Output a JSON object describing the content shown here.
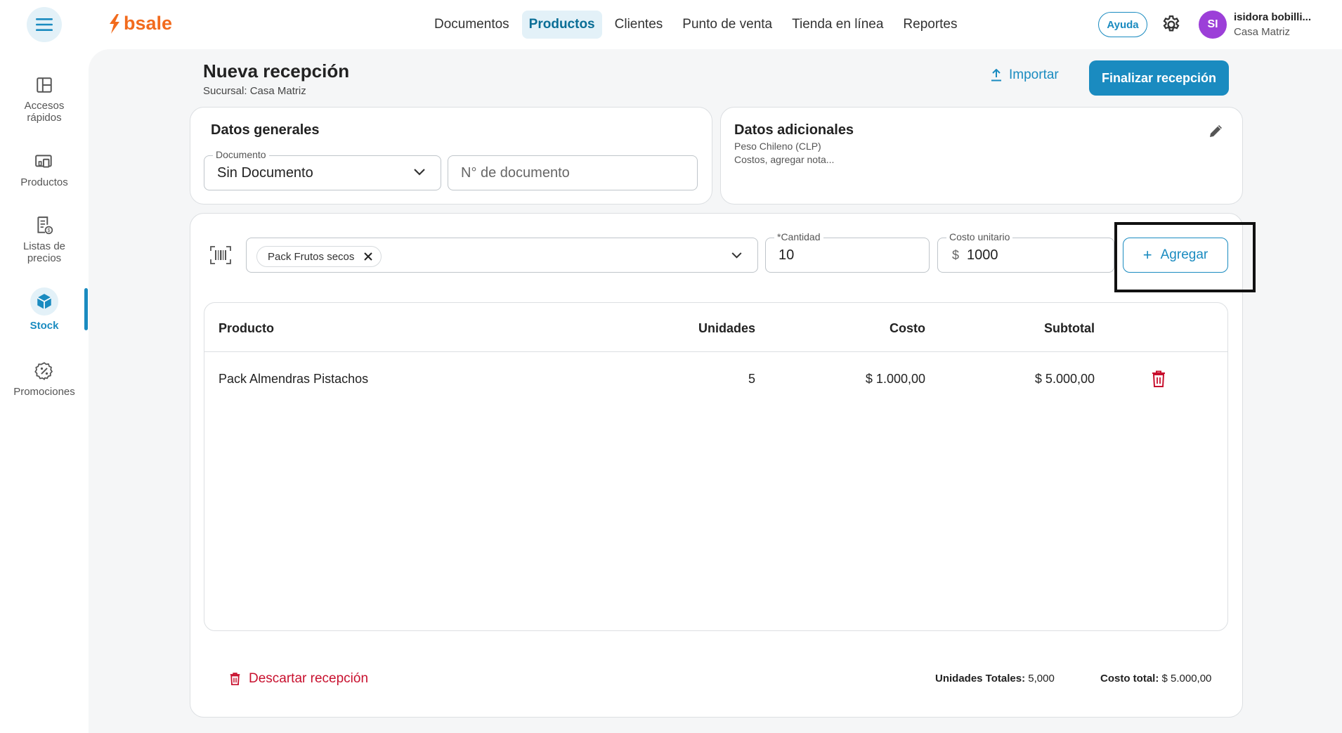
{
  "brand": {
    "name": "bsale",
    "color": "#f26b1d"
  },
  "nav": {
    "items": [
      "Documentos",
      "Productos",
      "Clientes",
      "Punto de venta",
      "Tienda en línea",
      "Reportes"
    ],
    "active": "Productos"
  },
  "header": {
    "help_label": "Ayuda",
    "avatar_initials": "SI",
    "user_name": "isidora bobilli...",
    "user_branch": "Casa Matriz"
  },
  "sidebar": {
    "items": [
      {
        "label": "Accesos rápidos",
        "icon": "layout-icon"
      },
      {
        "label": "Productos",
        "icon": "devices-icon"
      },
      {
        "label": "Listas de precios",
        "icon": "price-list-icon"
      },
      {
        "label": "Stock",
        "icon": "box-icon",
        "active": true
      },
      {
        "label": "Promociones",
        "icon": "discount-badge-icon"
      }
    ]
  },
  "page": {
    "title": "Nueva recepción",
    "subtitle": "Sucursal: Casa Matriz",
    "import_label": "Importar",
    "finish_label": "Finalizar recepción"
  },
  "general": {
    "title": "Datos generales",
    "document_label": "Documento",
    "document_value": "Sin Documento",
    "doc_number_placeholder": "N° de documento"
  },
  "additional": {
    "title": "Datos adicionales",
    "currency": "Peso Chileno (CLP)",
    "hint": "Costos, agregar nota..."
  },
  "entry": {
    "product_chip": "Pack Frutos secos",
    "quantity_label": "*Cantidad",
    "quantity_value": "10",
    "cost_label": "Costo unitario",
    "cost_prefix": "$",
    "cost_value": "1000",
    "add_label": "Agregar"
  },
  "table": {
    "headers": {
      "product": "Producto",
      "units": "Unidades",
      "cost": "Costo",
      "subtotal": "Subtotal"
    },
    "rows": [
      {
        "product": "Pack Almendras Pistachos",
        "units": "5",
        "cost": "$ 1.000,00",
        "subtotal": "$ 5.000,00"
      }
    ]
  },
  "footer": {
    "discard_label": "Descartar recepción",
    "units_total_label": "Unidades Totales:",
    "units_total_value": "5,000",
    "cost_total_label": "Costo total:",
    "cost_total_value": "$ 5.000,00"
  },
  "colors": {
    "accent": "#1a8bc0",
    "danger": "#c8102e",
    "avatar": "#9c3fd8"
  }
}
